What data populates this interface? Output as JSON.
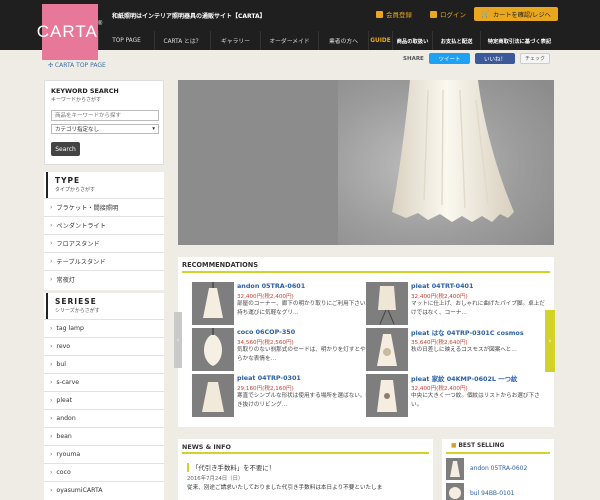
{
  "header": {
    "logo": "CARTA",
    "logo_mark": "®",
    "tagline": "和紙照明はインテリア照明器具の通販サイト【CARTA】",
    "member_label": "会員登録",
    "login_label": "ログイン",
    "cart_label": "カートを確認/レジへ"
  },
  "nav": {
    "items": [
      "TOP PAGE",
      "CARTA とは？",
      "ギャラリー",
      "オーダーメイド",
      "業者の方へ",
      "GUIDE",
      "商品の取扱い",
      "お支払と配送",
      "特定商取引法に基づく表記"
    ]
  },
  "breadcrumb": "✣ CARTA TOP PAGE",
  "share": {
    "label": "SHARE",
    "tweet": "ツイート",
    "like": "いいね！",
    "check": "チェック"
  },
  "search": {
    "title": "KEYWORD SEARCH",
    "subtitle": "キーワードからさがす",
    "placeholder": "商品をキーワードから探す",
    "category": "カテゴリ指定なし",
    "button": "Search"
  },
  "type_section": {
    "title": "TYPE",
    "subtitle": "タイプからさがす",
    "items": [
      "ブラケット・間接照明",
      "ペンダントライト",
      "フロアスタンド",
      "テーブルスタンド",
      "常夜灯"
    ]
  },
  "series_section": {
    "title": "SERIESE",
    "subtitle": "シリーズからさがす",
    "items": [
      "tag lamp",
      "revo",
      "bul",
      "s-carve",
      "pleat",
      "andon",
      "bean",
      "ryouma",
      "coco",
      "oyasumiCARTA"
    ]
  },
  "recommendations": {
    "title": "RECOMMENDATIONS",
    "items": [
      {
        "name": "andon 05TRA-0601",
        "price": "32,400円(税2,400円)",
        "desc": "部屋のコーナー、廊下の明かり取りにご利用下さい。持ち運びに気軽なグリ…"
      },
      {
        "name": "pleat 04TRT-0401",
        "price": "32,400円(税2,400円)",
        "desc": "マットに仕上げ、おしゃれに曲げたパイプ脚。卓上だけではなく、コーナ…"
      },
      {
        "name": "coco 06COP-350",
        "price": "34,560円(税2,560円)",
        "desc": "気取りのない刹那式のセードは、明かりを灯すとやわらかな表情を…"
      },
      {
        "name": "pleat はな 04TRP-0301C cosmos",
        "price": "35,640円(税2,640円)",
        "desc": "秋の日差しに映えるコスモスが図案へと…"
      },
      {
        "name": "pleat 04TRP-0301",
        "price": "29,160円(税2,160円)",
        "desc": "寒直でシンプルな形状は使用する場所を選ばない。吹き抜けのリビング…"
      },
      {
        "name": "pleat 家紋 04KMP-0602L 一つ紋",
        "price": "32,400円(税2,400円)",
        "desc": "中央に大きく一つ紋。個紋はリストからお選び下さい。"
      }
    ]
  },
  "news": {
    "title": "NEWS & INFO",
    "item_title": "「代引き手数料」を不要に！",
    "item_date": "2016年7月24日（日）",
    "item_body": "従来、別途ご請求いたしておりました代引き手数料は本日より不要といたしま"
  },
  "best_selling": {
    "title": "BEST SELLING",
    "items": [
      "andon 05TRA-0602",
      "bul 94BB-0101"
    ]
  },
  "colors": {
    "logo_pink": "#e7789a",
    "accent_gold": "#e8a71e",
    "accent_yellow": "#d2d22a",
    "link_blue": "#2b5fa3",
    "price_red": "#cc3d2f"
  }
}
